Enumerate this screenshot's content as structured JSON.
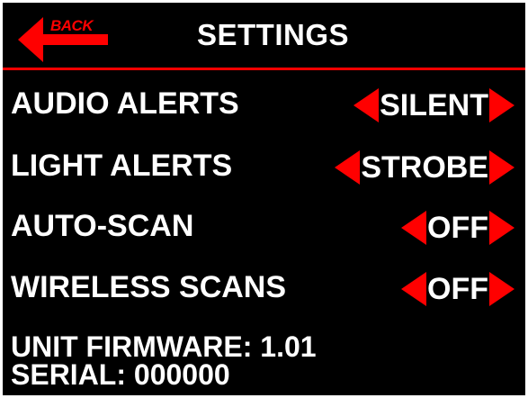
{
  "header": {
    "back_label": "BACK",
    "title": "SETTINGS"
  },
  "settings": [
    {
      "label": "AUDIO ALERTS",
      "value": "SILENT"
    },
    {
      "label": "LIGHT ALERTS",
      "value": "STROBE"
    },
    {
      "label": "AUTO-SCAN",
      "value": "OFF"
    },
    {
      "label": "WIRELESS SCANS",
      "value": "OFF"
    }
  ],
  "info": {
    "firmware": "UNIT FIRMWARE: 1.01",
    "serial": "SERIAL: 000000"
  },
  "icons": {
    "back": "left-arrow-icon",
    "decrease": "triangle-left-icon",
    "increase": "triangle-right-icon"
  },
  "colors": {
    "background": "#000000",
    "accent": "#ff0000",
    "text": "#ffffff",
    "frame": "#ffffff"
  }
}
